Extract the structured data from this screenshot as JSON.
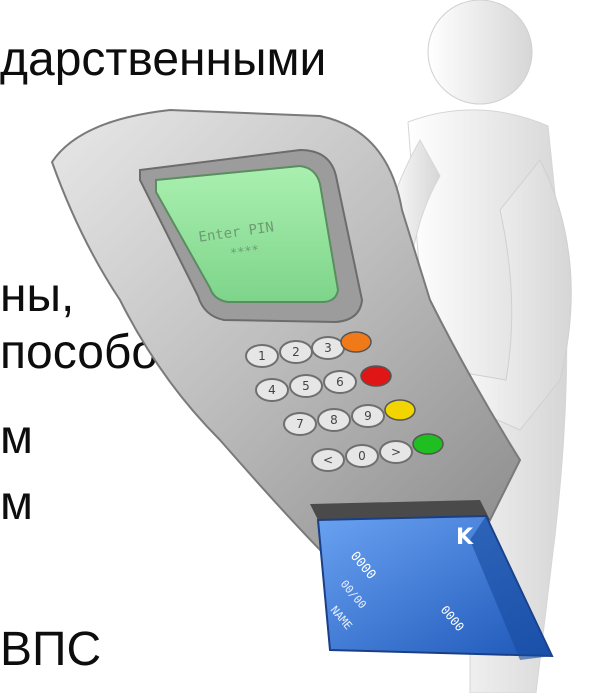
{
  "slide": {
    "lines": [
      "",
      "дарственными",
      "ны,",
      "пособом",
      "м",
      "м",
      "ВПС"
    ]
  },
  "terminal": {
    "screen_line_1": "Enter PIN",
    "screen_line_2": "****",
    "keys": [
      "1",
      "2",
      "3",
      "4",
      "5",
      "6",
      "7",
      "8",
      "9",
      "<",
      "0",
      ">"
    ]
  },
  "card": {
    "number_a": "0000",
    "number_b": "0000",
    "expiry": "00/00",
    "name": "NAME",
    "brand_mark": "K"
  },
  "colors": {
    "text": "#0d0d0d",
    "screen": "#8fe39a",
    "card": "#2f6fd1",
    "key_orange": "#f07a1a",
    "key_red": "#e01616",
    "key_yellow": "#f2d400",
    "key_green": "#1fbf22"
  }
}
